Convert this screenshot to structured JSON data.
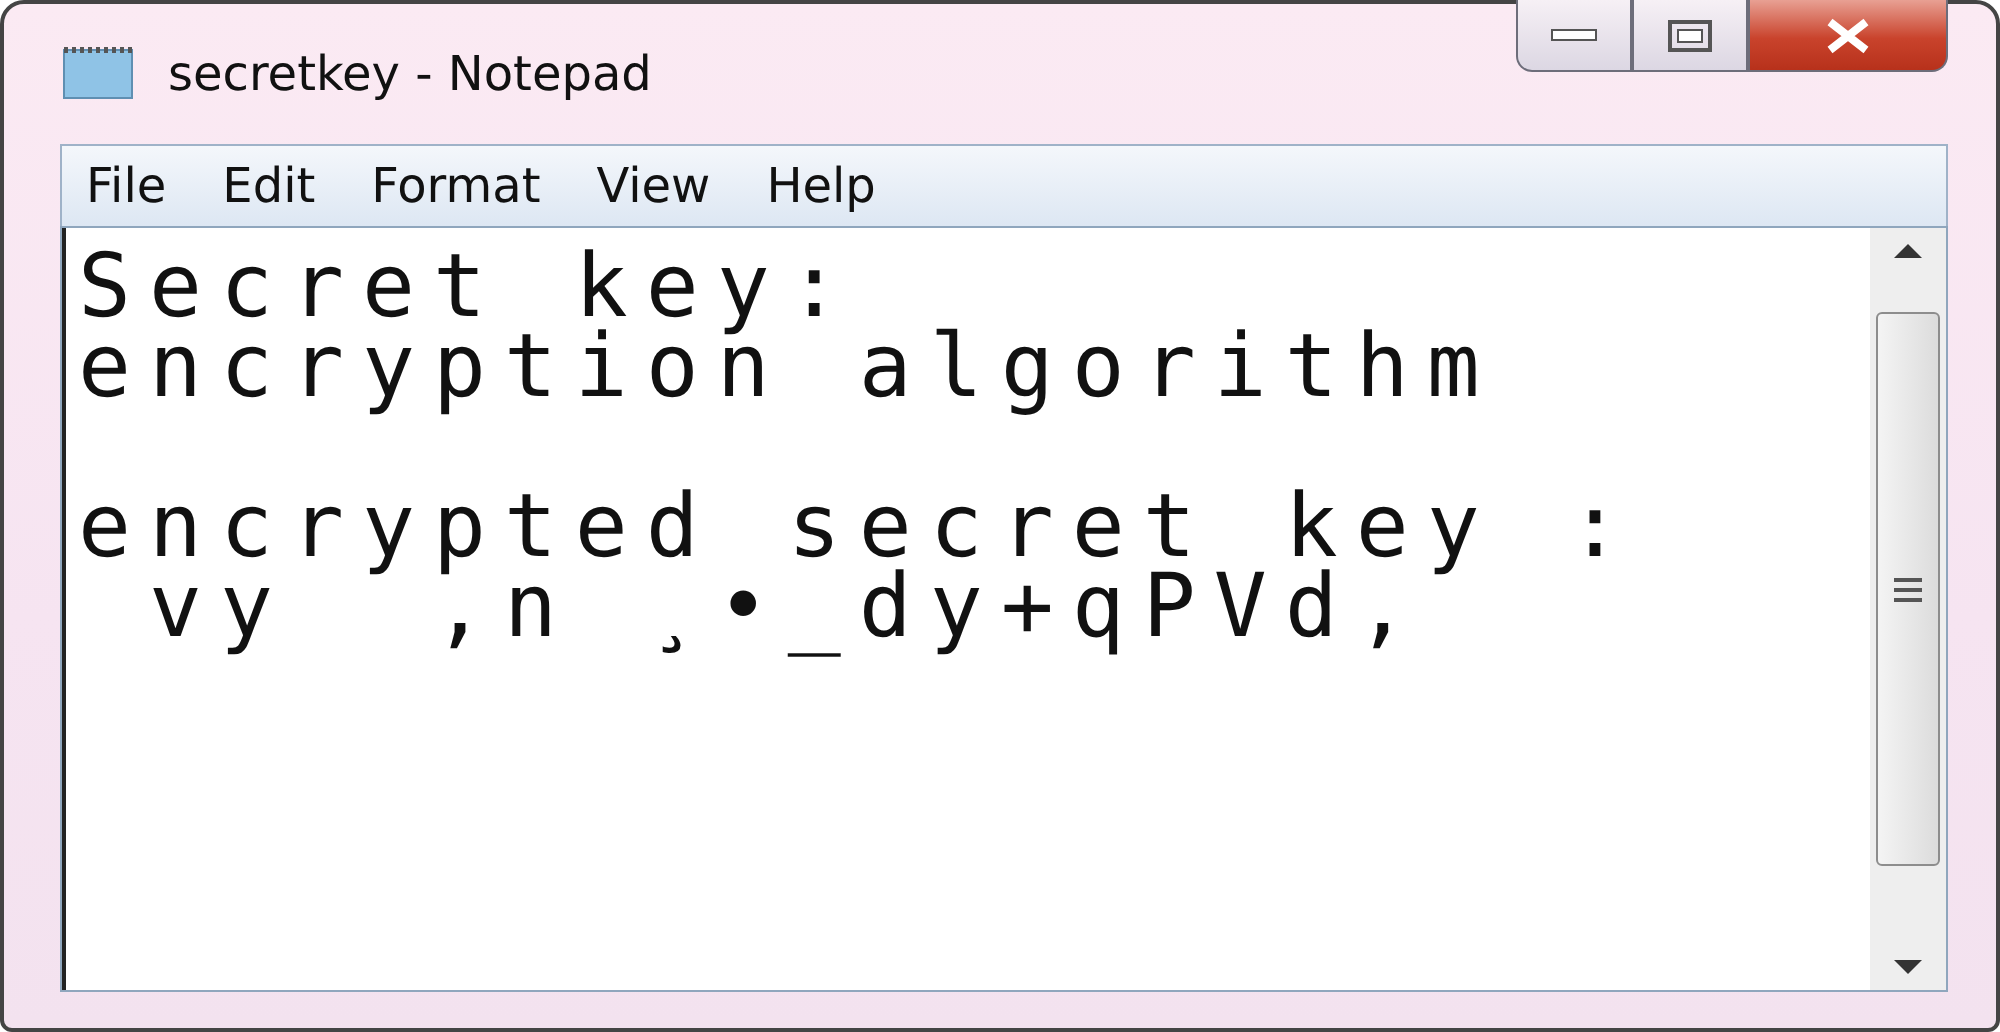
{
  "window": {
    "title": "secretkey - Notepad"
  },
  "menu": [
    "File",
    "Edit",
    "Format",
    "View",
    "Help"
  ],
  "editor": {
    "paragraphs": [
      [
        "Secret key:",
        "encryption algorithm"
      ],
      [
        "encrypted secret key :",
        " vy  ,n ¸•_dy+qPVd,"
      ]
    ]
  }
}
